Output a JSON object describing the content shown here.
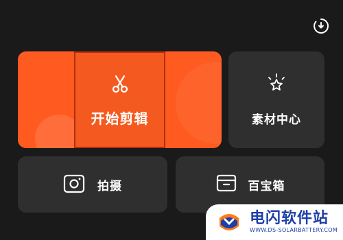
{
  "header": {
    "export_icon": "download-circle-icon"
  },
  "cards": {
    "start_edit": {
      "label": "开始剪辑",
      "icon": "scissors-icon",
      "color": "#ff5a1f"
    },
    "materials": {
      "label": "素材中心",
      "icon": "star-sparkle-icon"
    },
    "camera": {
      "label": "拍摄",
      "icon": "camera-icon"
    },
    "toolbox": {
      "label": "百宝箱",
      "icon": "box-icon"
    }
  },
  "watermark": {
    "title": "电闪软件站",
    "subtitle": "WWW.DS-SOLARBATTERY.COM"
  }
}
